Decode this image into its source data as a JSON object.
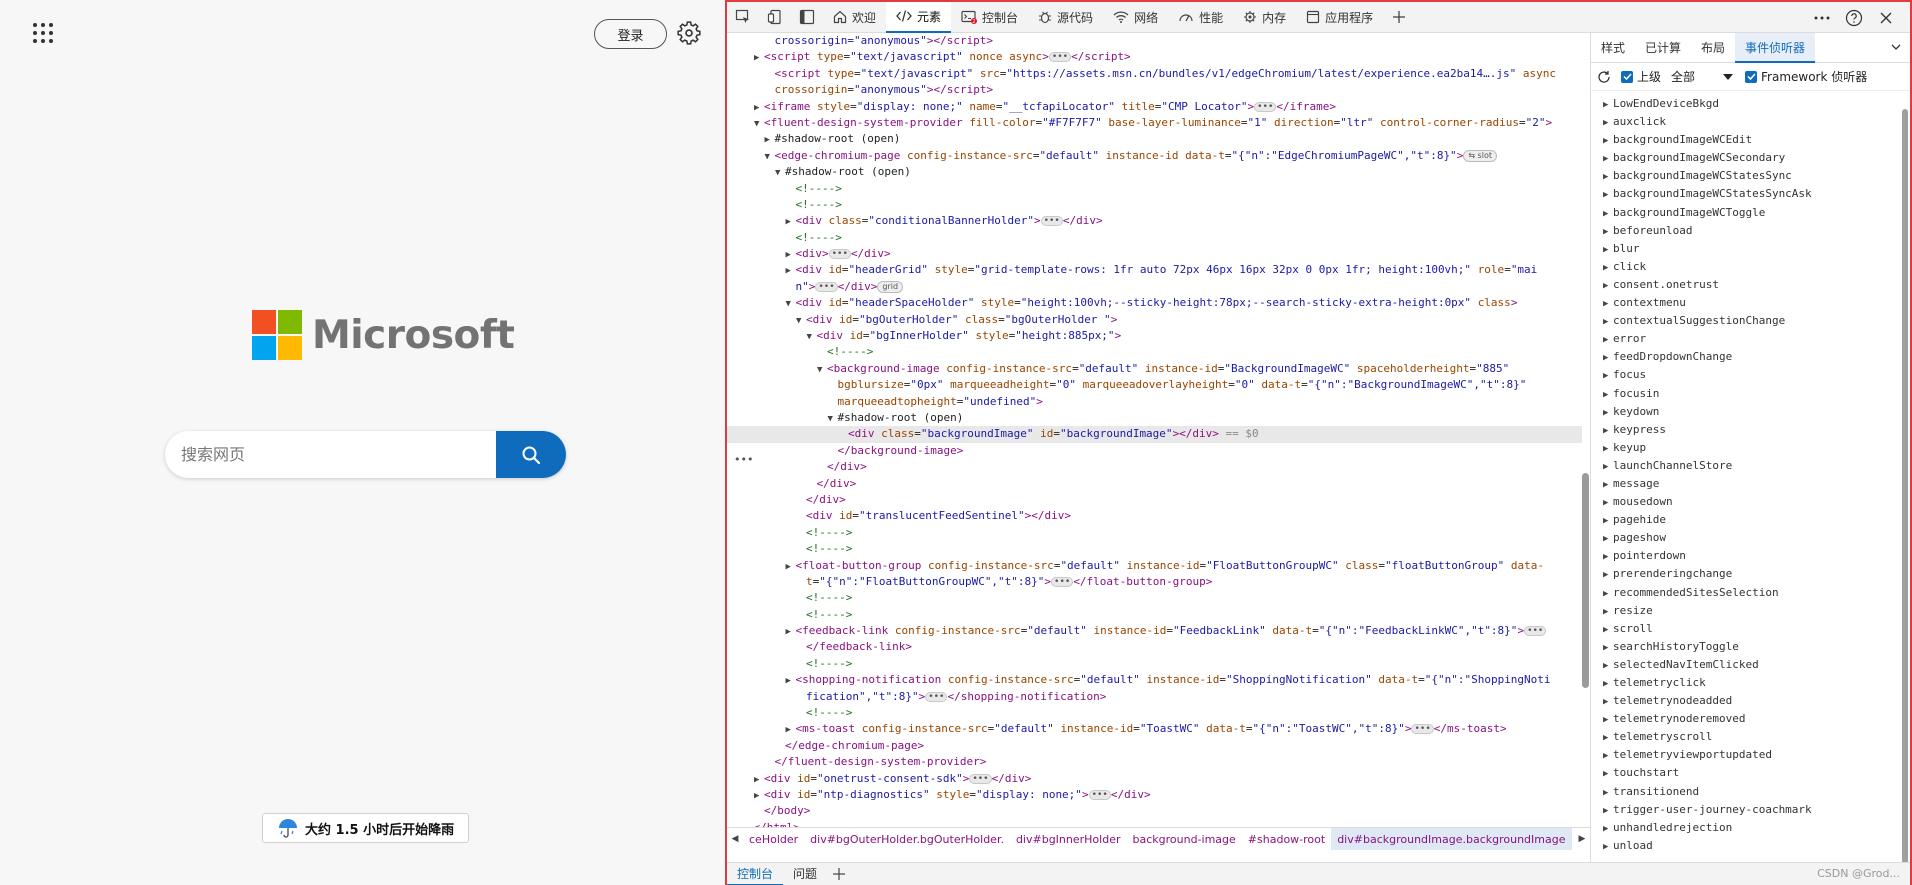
{
  "page": {
    "login_label": "登录",
    "logo_text": "Microsoft",
    "search_placeholder": "搜索网页",
    "weather_text": "大约 1.5 小时后开始降雨"
  },
  "devtools": {
    "tabs": [
      {
        "label": "欢迎",
        "icon": "home-icon"
      },
      {
        "label": "元素",
        "icon": "code-icon"
      },
      {
        "label": "控制台",
        "icon": "console-icon"
      },
      {
        "label": "源代码",
        "icon": "bug-icon"
      },
      {
        "label": "网络",
        "icon": "wifi-icon"
      },
      {
        "label": "性能",
        "icon": "gauge-icon"
      },
      {
        "label": "内存",
        "icon": "memory-icon"
      },
      {
        "label": "应用程序",
        "icon": "app-icon"
      }
    ],
    "sidebar_tabs": [
      "样式",
      "已计算",
      "布局",
      "事件侦听器"
    ],
    "filter": {
      "ancestors": "上级",
      "select_value": "全部",
      "framework": "Framework 侦听器"
    },
    "events": [
      "LowEndDeviceBkgd",
      "auxclick",
      "backgroundImageWCEdit",
      "backgroundImageWCSecondary",
      "backgroundImageWCStatesSync",
      "backgroundImageWCStatesSyncAsk",
      "backgroundImageWCToggle",
      "beforeunload",
      "blur",
      "click",
      "consent.onetrust",
      "contextmenu",
      "contextualSuggestionChange",
      "error",
      "feedDropdownChange",
      "focus",
      "focusin",
      "keydown",
      "keypress",
      "keyup",
      "launchChannelStore",
      "message",
      "mousedown",
      "pagehide",
      "pageshow",
      "pointerdown",
      "prerenderingchange",
      "recommendedSitesSelection",
      "resize",
      "scroll",
      "searchHistoryToggle",
      "selectedNavItemClicked",
      "telemetryclick",
      "telemetrynodeadded",
      "telemetrynoderemoved",
      "telemetryscroll",
      "telemetryviewportupdated",
      "touchstart",
      "transitionend",
      "trigger-user-journey-coachmark",
      "unhandledrejection",
      "unload"
    ],
    "breadcrumb": [
      "ceHolder",
      "div#bgOuterHolder.bgOuterHolder.",
      "div#bgInnerHolder",
      "background-image",
      "#shadow-root",
      "div#backgroundImage.backgroundImage"
    ],
    "drawer_tabs": [
      "控制台",
      "问题"
    ],
    "watermark": "CSDN @Grod...",
    "dom_lines": [
      {
        "i": 3,
        "t": "",
        "h": "<span class=\"val\">crossorigin=\"anonymous\"</span><span class=\"tag\">&gt;&lt;/script&gt;</span>"
      },
      {
        "i": 2,
        "t": "▶",
        "h": "<span class=\"tag\">&lt;script</span> <span class=\"attr\">type</span>=<span class=\"val\">\"text/javascript\"</span> <span class=\"attr\">nonce async</span><span class=\"tag\">&gt;</span><span class=\"ell\">•••</span><span class=\"tag\">&lt;/script&gt;</span>"
      },
      {
        "i": 3,
        "t": "",
        "h": "<span class=\"tag\">&lt;script</span> <span class=\"attr\">type</span>=<span class=\"val\">\"text/javascript\"</span> <span class=\"attr\">src</span>=<span class=\"val\">\"https://assets.msn.cn/bundles/v1/edgeChromium/latest/experience.ea2ba14….js\"</span> <span class=\"attr\">async</span>"
      },
      {
        "i": 3,
        "t": "",
        "h": "<span class=\"attr\">crossorigin</span>=<span class=\"val\">\"anonymous\"</span><span class=\"tag\">&gt;&lt;/script&gt;</span>"
      },
      {
        "i": 2,
        "t": "▶",
        "h": "<span class=\"tag\">&lt;iframe</span> <span class=\"attr\">style</span>=<span class=\"val\">\"display: none;\"</span> <span class=\"attr\">name</span>=<span class=\"val\">\"__tcfapiLocator\"</span> <span class=\"attr\">title</span>=<span class=\"val\">\"CMP Locator\"</span><span class=\"tag\">&gt;</span><span class=\"ell\">•••</span><span class=\"tag\">&lt;/iframe&gt;</span>"
      },
      {
        "i": 2,
        "t": "▼",
        "h": "<span class=\"tag\">&lt;fluent-design-system-provider</span> <span class=\"attr\">fill-color</span>=<span class=\"val\">\"#F7F7F7\"</span> <span class=\"attr\">base-layer-luminance</span>=<span class=\"val\">\"1\"</span> <span class=\"attr\">direction</span>=<span class=\"val\">\"ltr\"</span> <span class=\"attr\">control-corner-radius</span>=<span class=\"val\">\"2\"</span><span class=\"tag\">&gt;</span>"
      },
      {
        "i": 3,
        "t": "▶",
        "h": "<span class=\"txt\">#shadow-root (open)</span>"
      },
      {
        "i": 3,
        "t": "▼",
        "h": "<span class=\"tag\">&lt;edge-chromium-page</span> <span class=\"attr\">config-instance-src</span>=<span class=\"val\">\"default\"</span> <span class=\"attr\">instance-id data-t</span>=<span class=\"val\">\"{\"n\":\"EdgeChromiumPageWC\",\"t\":8}\"</span><span class=\"tag\">&gt;</span><span class=\"badge\">⇆ slot</span>"
      },
      {
        "i": 4,
        "t": "▼",
        "h": "<span class=\"txt\">#shadow-root (open)</span>"
      },
      {
        "i": 5,
        "t": "",
        "h": "<span class=\"cmt\">&lt;!----&gt;</span>"
      },
      {
        "i": 5,
        "t": "",
        "h": "<span class=\"cmt\">&lt;!----&gt;</span>"
      },
      {
        "i": 5,
        "t": "▶",
        "h": "<span class=\"tag\">&lt;div</span> <span class=\"attr\">class</span>=<span class=\"val\">\"conditionalBannerHolder\"</span><span class=\"tag\">&gt;</span><span class=\"ell\">•••</span><span class=\"tag\">&lt;/div&gt;</span>"
      },
      {
        "i": 5,
        "t": "",
        "h": "<span class=\"cmt\">&lt;!----&gt;</span>"
      },
      {
        "i": 5,
        "t": "▶",
        "h": "<span class=\"tag\">&lt;div&gt;</span><span class=\"ell\">•••</span><span class=\"tag\">&lt;/div&gt;</span>"
      },
      {
        "i": 5,
        "t": "▶",
        "h": "<span class=\"tag\">&lt;div</span> <span class=\"attr\">id</span>=<span class=\"val\">\"headerGrid\"</span> <span class=\"attr\">style</span>=<span class=\"val\">\"grid-template-rows: 1fr auto 72px 46px 16px 32px 0 0px 1fr; height:100vh;\"</span> <span class=\"attr\">role</span>=<span class=\"val\">\"mai</span>"
      },
      {
        "i": 5,
        "t": "",
        "h": "<span class=\"val\">n\"</span><span class=\"tag\">&gt;</span><span class=\"ell\">•••</span><span class=\"tag\">&lt;/div&gt;</span><span class=\"badge\">grid</span>"
      },
      {
        "i": 5,
        "t": "▼",
        "h": "<span class=\"tag\">&lt;div</span> <span class=\"attr\">id</span>=<span class=\"val\">\"headerSpaceHolder\"</span> <span class=\"attr\">style</span>=<span class=\"val\">\"height:100vh;--sticky-height:78px;--search-sticky-extra-height:0px\"</span> <span class=\"attr\">class</span><span class=\"tag\">&gt;</span>"
      },
      {
        "i": 6,
        "t": "▼",
        "h": "<span class=\"tag\">&lt;div</span> <span class=\"attr\">id</span>=<span class=\"val\">\"bgOuterHolder\"</span> <span class=\"attr\">class</span>=<span class=\"val\">\"bgOuterHolder \"</span><span class=\"tag\">&gt;</span>"
      },
      {
        "i": 7,
        "t": "▼",
        "h": "<span class=\"tag\">&lt;div</span> <span class=\"attr\">id</span>=<span class=\"val\">\"bgInnerHolder\"</span> <span class=\"attr\">style</span>=<span class=\"val\">\"height:885px;\"</span><span class=\"tag\">&gt;</span>"
      },
      {
        "i": 8,
        "t": "",
        "h": "<span class=\"cmt\">&lt;!----&gt;</span>"
      },
      {
        "i": 8,
        "t": "▼",
        "h": "<span class=\"tag\">&lt;background-image</span> <span class=\"attr\">config-instance-src</span>=<span class=\"val\">\"default\"</span> <span class=\"attr\">instance-id</span>=<span class=\"val\">\"BackgroundImageWC\"</span> <span class=\"attr\">spaceholderheight</span>=<span class=\"val\">\"885\"</span>"
      },
      {
        "i": 9,
        "t": "",
        "h": "<span class=\"attr\">bgblursize</span>=<span class=\"val\">\"0px\"</span> <span class=\"attr\">marqueeadheight</span>=<span class=\"val\">\"0\"</span> <span class=\"attr\">marqueeadoverlayheight</span>=<span class=\"val\">\"0\"</span> <span class=\"attr\">data-t</span>=<span class=\"val\">\"{\"n\":\"BackgroundImageWC\",\"t\":8}\"</span>"
      },
      {
        "i": 9,
        "t": "",
        "h": "<span class=\"attr\">marqueeadtopheight</span>=<span class=\"val\">\"undefined\"</span><span class=\"tag\">&gt;</span>"
      },
      {
        "i": 9,
        "t": "▼",
        "h": "<span class=\"txt\">#shadow-root (open)</span>"
      },
      {
        "i": 10,
        "t": "",
        "sel": true,
        "h": "<span class=\"tag\">&lt;div</span> <span class=\"attr\">class</span>=<span class=\"val\">\"backgroundImage\"</span> <span class=\"attr\">id</span>=<span class=\"val\">\"backgroundImage\"</span><span class=\"tag\">&gt;&lt;/div&gt;</span> <span class=\"eqsel\">== $0</span>"
      },
      {
        "i": 9,
        "t": "",
        "h": "<span class=\"tag\">&lt;/background-image&gt;</span>"
      },
      {
        "i": 8,
        "t": "",
        "h": "<span class=\"tag\">&lt;/div&gt;</span>"
      },
      {
        "i": 7,
        "t": "",
        "h": "<span class=\"tag\">&lt;/div&gt;</span>"
      },
      {
        "i": 6,
        "t": "",
        "h": "<span class=\"tag\">&lt;/div&gt;</span>"
      },
      {
        "i": 6,
        "t": "",
        "h": "<span class=\"tag\">&lt;div</span> <span class=\"attr\">id</span>=<span class=\"val\">\"translucentFeedSentinel\"</span><span class=\"tag\">&gt;&lt;/div&gt;</span>"
      },
      {
        "i": 6,
        "t": "",
        "h": "<span class=\"cmt\">&lt;!----&gt;</span>"
      },
      {
        "i": 6,
        "t": "",
        "h": "<span class=\"cmt\">&lt;!----&gt;</span>"
      },
      {
        "i": 5,
        "t": "▶",
        "h": "<span class=\"tag\">&lt;float-button-group</span> <span class=\"attr\">config-instance-src</span>=<span class=\"val\">\"default\"</span> <span class=\"attr\">instance-id</span>=<span class=\"val\">\"FloatButtonGroupWC\"</span> <span class=\"attr\">class</span>=<span class=\"val\">\"floatButtonGroup\"</span> <span class=\"attr\">data-</span>"
      },
      {
        "i": 6,
        "t": "",
        "h": "<span class=\"attr\">t</span>=<span class=\"val\">\"{\"n\":\"FloatButtonGroupWC\",\"t\":8}\"</span><span class=\"tag\">&gt;</span><span class=\"ell\">•••</span><span class=\"tag\">&lt;/float-button-group&gt;</span>"
      },
      {
        "i": 6,
        "t": "",
        "h": "<span class=\"cmt\">&lt;!----&gt;</span>"
      },
      {
        "i": 6,
        "t": "",
        "h": "<span class=\"cmt\">&lt;!----&gt;</span>"
      },
      {
        "i": 5,
        "t": "▶",
        "h": "<span class=\"tag\">&lt;feedback-link</span> <span class=\"attr\">config-instance-src</span>=<span class=\"val\">\"default\"</span> <span class=\"attr\">instance-id</span>=<span class=\"val\">\"FeedbackLink\"</span> <span class=\"attr\">data-t</span>=<span class=\"val\">\"{\"n\":\"FeedbackLinkWC\",\"t\":8}\"</span><span class=\"tag\">&gt;</span><span class=\"ell\">•••</span>"
      },
      {
        "i": 6,
        "t": "",
        "h": "<span class=\"tag\">&lt;/feedback-link&gt;</span>"
      },
      {
        "i": 6,
        "t": "",
        "h": "<span class=\"cmt\">&lt;!----&gt;</span>"
      },
      {
        "i": 5,
        "t": "▶",
        "h": "<span class=\"tag\">&lt;shopping-notification</span> <span class=\"attr\">config-instance-src</span>=<span class=\"val\">\"default\"</span> <span class=\"attr\">instance-id</span>=<span class=\"val\">\"ShoppingNotification\"</span> <span class=\"attr\">data-t</span>=<span class=\"val\">\"{\"n\":\"ShoppingNoti</span>"
      },
      {
        "i": 6,
        "t": "",
        "h": "<span class=\"val\">fication\",\"t\":8}\"</span><span class=\"tag\">&gt;</span><span class=\"ell\">•••</span><span class=\"tag\">&lt;/shopping-notification&gt;</span>"
      },
      {
        "i": 6,
        "t": "",
        "h": "<span class=\"cmt\">&lt;!----&gt;</span>"
      },
      {
        "i": 5,
        "t": "▶",
        "h": "<span class=\"tag\">&lt;ms-toast</span> <span class=\"attr\">config-instance-src</span>=<span class=\"val\">\"default\"</span> <span class=\"attr\">instance-id</span>=<span class=\"val\">\"ToastWC\"</span> <span class=\"attr\">data-t</span>=<span class=\"val\">\"{\"n\":\"ToastWC\",\"t\":8}\"</span><span class=\"tag\">&gt;</span><span class=\"ell\">•••</span><span class=\"tag\">&lt;/ms-toast&gt;</span>"
      },
      {
        "i": 4,
        "t": "",
        "h": "<span class=\"tag\">&lt;/edge-chromium-page&gt;</span>"
      },
      {
        "i": 3,
        "t": "",
        "h": "<span class=\"tag\">&lt;/fluent-design-system-provider&gt;</span>"
      },
      {
        "i": 2,
        "t": "▶",
        "h": "<span class=\"tag\">&lt;div</span> <span class=\"attr\">id</span>=<span class=\"val\">\"onetrust-consent-sdk\"</span><span class=\"tag\">&gt;</span><span class=\"ell\">•••</span><span class=\"tag\">&lt;/div&gt;</span>"
      },
      {
        "i": 2,
        "t": "▶",
        "h": "<span class=\"tag\">&lt;div</span> <span class=\"attr\">id</span>=<span class=\"val\">\"ntp-diagnostics\"</span> <span class=\"attr\">style</span>=<span class=\"val\">\"display: none;\"</span><span class=\"tag\">&gt;</span><span class=\"ell\">•••</span><span class=\"tag\">&lt;/div&gt;</span>"
      },
      {
        "i": 2,
        "t": "",
        "h": "<span class=\"tag\">&lt;/body&gt;</span>"
      },
      {
        "i": 1,
        "t": "",
        "h": "<span class=\"tag\">&lt;/html&gt;</span>"
      }
    ]
  }
}
